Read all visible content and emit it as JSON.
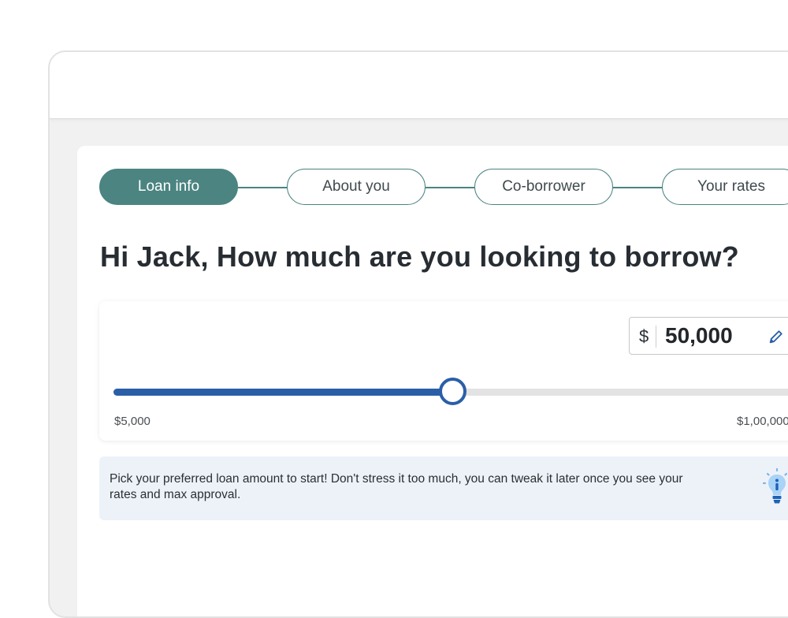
{
  "stepper": {
    "steps": [
      {
        "label": "Loan info",
        "active": true
      },
      {
        "label": "About you",
        "active": false
      },
      {
        "label": "Co-borrower",
        "active": false
      },
      {
        "label": "Your rates",
        "active": false
      }
    ]
  },
  "heading": "Hi Jack, How much are you looking to borrow?",
  "loan": {
    "currency_symbol": "$",
    "amount": "50,000",
    "min_label": "$5,000",
    "max_label": "$1,00,000",
    "slider_fraction": 0.478
  },
  "tip": {
    "text": "Pick your preferred loan amount to start! Don't stress it too much, you can tweak it later once you see your rates and max approval."
  },
  "icons": {
    "edit": "pencil-icon",
    "tip": "lightbulb-icon"
  },
  "colors": {
    "accent": "#4b8480",
    "slider": "#2a5fa8",
    "tip_background": "#edf2f9"
  }
}
